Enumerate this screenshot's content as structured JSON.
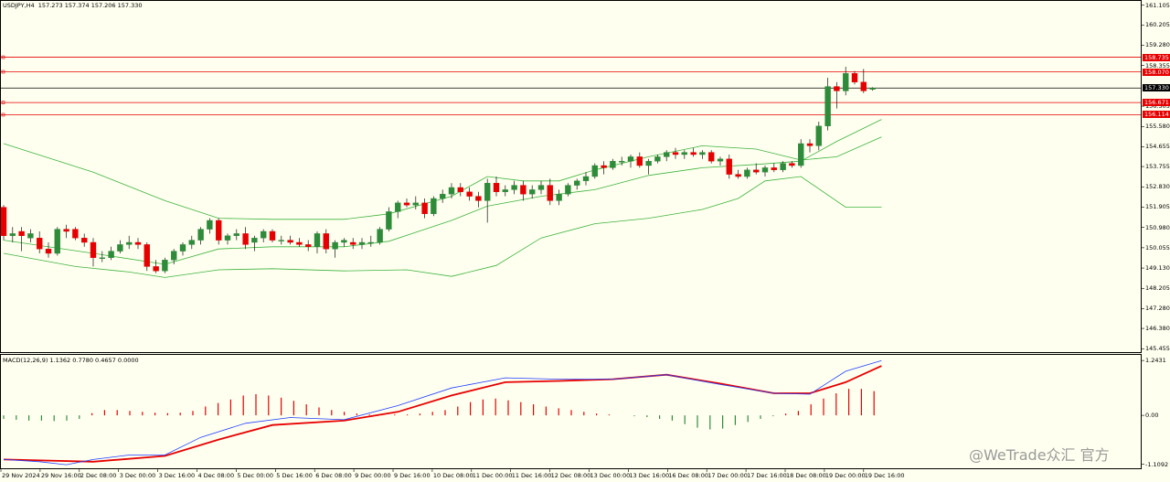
{
  "header": {
    "symbol": "USDJPY,H4",
    "ohlc": "157.273 157.374 157.206 157.330"
  },
  "macd_header": {
    "label": "MACD(12,26,9) 1.1362 0.7780 0.4657 0.0000"
  },
  "watermark": "@WeTrade众汇 官方",
  "price_labels": [
    {
      "text": "161.105",
      "v": 161.105
    },
    {
      "text": "160.205",
      "v": 160.205
    },
    {
      "text": "159.280",
      "v": 159.28
    },
    {
      "text": "158.355",
      "v": 158.355
    },
    {
      "text": "156.505",
      "v": 156.505
    },
    {
      "text": "155.580",
      "v": 155.58
    },
    {
      "text": "154.655",
      "v": 154.655
    },
    {
      "text": "153.755",
      "v": 153.755
    },
    {
      "text": "152.830",
      "v": 152.83
    },
    {
      "text": "151.905",
      "v": 151.905
    },
    {
      "text": "150.980",
      "v": 150.98
    },
    {
      "text": "150.055",
      "v": 150.055
    },
    {
      "text": "149.130",
      "v": 149.13
    },
    {
      "text": "148.205",
      "v": 148.205
    },
    {
      "text": "147.280",
      "v": 147.28
    },
    {
      "text": "146.380",
      "v": 146.38
    },
    {
      "text": "145.455",
      "v": 145.455
    }
  ],
  "level_tags": [
    {
      "text": "158.735",
      "v": 158.735,
      "color": "#e60000"
    },
    {
      "text": "158.070",
      "v": 158.07,
      "color": "#e60000"
    },
    {
      "text": "157.330",
      "v": 157.33,
      "color": "#000000"
    },
    {
      "text": "156.671",
      "v": 156.671,
      "color": "#e60000"
    },
    {
      "text": "156.114",
      "v": 156.114,
      "color": "#e60000"
    }
  ],
  "macd_labels": [
    {
      "text": "1.2431",
      "v": 1.2431
    },
    {
      "text": "0.00",
      "v": 0.0
    },
    {
      "text": "-1.1092",
      "v": -1.1092
    }
  ],
  "time_labels": [
    "29 Nov 2024",
    "29 Nov 16:00",
    "2 Dec 08:00",
    "3 Dec 00:00",
    "3 Dec 16:00",
    "4 Dec 08:00",
    "5 Dec 00:00",
    "5 Dec 16:00",
    "6 Dec 08:00",
    "9 Dec 00:00",
    "9 Dec 16:00",
    "10 Dec 08:00",
    "11 Dec 00:00",
    "11 Dec 16:00",
    "12 Dec 08:00",
    "13 Dec 00:00",
    "13 Dec 16:00",
    "16 Dec 08:00",
    "17 Dec 00:00",
    "17 Dec 16:00",
    "18 Dec 08:00",
    "19 Dec 00:00",
    "19 Dec 16:00"
  ],
  "colors": {
    "background": "#fffff0",
    "bull": "#2e8b3a",
    "bear": "#e60000",
    "bands": "#3cb43c",
    "level": "#e60000",
    "current": "#000000",
    "macd_line": "#1f3fff",
    "signal_line": "#e60000"
  },
  "chart_data": [
    {
      "type": "candlestick",
      "symbol": "USDJPY",
      "timeframe": "H4",
      "indicators": [
        "Bollinger Bands",
        "Horizontal levels"
      ],
      "ylim": [
        145.3,
        161.3
      ],
      "candles": [
        {
          "o": 151.9,
          "h": 152.0,
          "l": 150.4,
          "c": 150.6
        },
        {
          "o": 150.6,
          "h": 151.0,
          "l": 150.3,
          "c": 150.7
        },
        {
          "o": 150.8,
          "h": 151.0,
          "l": 149.9,
          "c": 150.6
        },
        {
          "o": 150.5,
          "h": 150.9,
          "l": 150.3,
          "c": 150.7
        },
        {
          "o": 150.5,
          "h": 150.8,
          "l": 149.8,
          "c": 150.0
        },
        {
          "o": 150.0,
          "h": 150.3,
          "l": 149.6,
          "c": 149.8
        },
        {
          "o": 149.8,
          "h": 151.0,
          "l": 149.7,
          "c": 150.9
        },
        {
          "o": 150.9,
          "h": 151.1,
          "l": 150.5,
          "c": 150.8
        },
        {
          "o": 150.9,
          "h": 151.0,
          "l": 150.4,
          "c": 150.5
        },
        {
          "o": 150.5,
          "h": 150.7,
          "l": 150.1,
          "c": 150.3
        },
        {
          "o": 150.3,
          "h": 150.5,
          "l": 149.2,
          "c": 149.6
        },
        {
          "o": 149.6,
          "h": 149.9,
          "l": 149.4,
          "c": 149.6
        },
        {
          "o": 149.6,
          "h": 150.1,
          "l": 149.5,
          "c": 149.9
        },
        {
          "o": 149.9,
          "h": 150.4,
          "l": 149.8,
          "c": 150.2
        },
        {
          "o": 150.2,
          "h": 150.6,
          "l": 150.0,
          "c": 150.3
        },
        {
          "o": 150.3,
          "h": 150.5,
          "l": 150.0,
          "c": 150.2
        },
        {
          "o": 150.2,
          "h": 150.3,
          "l": 149.0,
          "c": 149.2
        },
        {
          "o": 149.2,
          "h": 149.5,
          "l": 148.9,
          "c": 149.0
        },
        {
          "o": 149.0,
          "h": 149.6,
          "l": 148.9,
          "c": 149.5
        },
        {
          "o": 149.5,
          "h": 150.0,
          "l": 149.3,
          "c": 149.9
        },
        {
          "o": 149.9,
          "h": 150.3,
          "l": 149.7,
          "c": 150.2
        },
        {
          "o": 150.2,
          "h": 150.6,
          "l": 150.0,
          "c": 150.4
        },
        {
          "o": 150.4,
          "h": 151.0,
          "l": 150.2,
          "c": 150.9
        },
        {
          "o": 150.9,
          "h": 151.4,
          "l": 150.7,
          "c": 151.3
        },
        {
          "o": 151.3,
          "h": 151.4,
          "l": 150.2,
          "c": 150.4
        },
        {
          "o": 150.4,
          "h": 150.7,
          "l": 150.2,
          "c": 150.6
        },
        {
          "o": 150.6,
          "h": 150.9,
          "l": 150.4,
          "c": 150.7
        },
        {
          "o": 150.7,
          "h": 151.0,
          "l": 150.0,
          "c": 150.2
        },
        {
          "o": 150.3,
          "h": 150.6,
          "l": 149.9,
          "c": 150.5
        },
        {
          "o": 150.5,
          "h": 150.9,
          "l": 150.3,
          "c": 150.8
        },
        {
          "o": 150.8,
          "h": 150.9,
          "l": 150.3,
          "c": 150.4
        },
        {
          "o": 150.4,
          "h": 150.6,
          "l": 150.2,
          "c": 150.4
        },
        {
          "o": 150.4,
          "h": 150.6,
          "l": 150.2,
          "c": 150.3
        },
        {
          "o": 150.3,
          "h": 150.5,
          "l": 150.1,
          "c": 150.2
        },
        {
          "o": 150.2,
          "h": 150.4,
          "l": 149.9,
          "c": 150.1
        },
        {
          "o": 150.1,
          "h": 150.8,
          "l": 149.8,
          "c": 150.7
        },
        {
          "o": 150.7,
          "h": 150.9,
          "l": 149.8,
          "c": 150.0
        },
        {
          "o": 150.0,
          "h": 150.4,
          "l": 149.6,
          "c": 150.3
        },
        {
          "o": 150.3,
          "h": 150.5,
          "l": 150.1,
          "c": 150.4
        },
        {
          "o": 150.3,
          "h": 150.5,
          "l": 150.0,
          "c": 150.2
        },
        {
          "o": 150.2,
          "h": 150.5,
          "l": 150.0,
          "c": 150.3
        },
        {
          "o": 150.3,
          "h": 150.6,
          "l": 150.1,
          "c": 150.3
        },
        {
          "o": 150.3,
          "h": 151.0,
          "l": 150.2,
          "c": 150.9
        },
        {
          "o": 150.9,
          "h": 151.9,
          "l": 150.8,
          "c": 151.7
        },
        {
          "o": 151.7,
          "h": 152.2,
          "l": 151.4,
          "c": 152.1
        },
        {
          "o": 152.1,
          "h": 152.3,
          "l": 151.9,
          "c": 152.0
        },
        {
          "o": 152.0,
          "h": 152.4,
          "l": 151.8,
          "c": 152.1
        },
        {
          "o": 152.1,
          "h": 152.3,
          "l": 151.4,
          "c": 151.6
        },
        {
          "o": 151.6,
          "h": 152.4,
          "l": 151.5,
          "c": 152.3
        },
        {
          "o": 152.3,
          "h": 152.7,
          "l": 152.1,
          "c": 152.5
        },
        {
          "o": 152.5,
          "h": 153.0,
          "l": 152.3,
          "c": 152.8
        },
        {
          "o": 152.8,
          "h": 153.0,
          "l": 152.4,
          "c": 152.6
        },
        {
          "o": 152.6,
          "h": 152.8,
          "l": 152.2,
          "c": 152.4
        },
        {
          "o": 152.4,
          "h": 152.6,
          "l": 151.9,
          "c": 152.2
        },
        {
          "o": 152.2,
          "h": 153.2,
          "l": 151.2,
          "c": 153.0
        },
        {
          "o": 153.0,
          "h": 153.3,
          "l": 152.4,
          "c": 152.6
        },
        {
          "o": 152.6,
          "h": 152.9,
          "l": 152.4,
          "c": 152.7
        },
        {
          "o": 152.7,
          "h": 153.1,
          "l": 152.5,
          "c": 152.9
        },
        {
          "o": 152.9,
          "h": 153.1,
          "l": 152.2,
          "c": 152.5
        },
        {
          "o": 152.5,
          "h": 152.9,
          "l": 152.3,
          "c": 152.7
        },
        {
          "o": 152.7,
          "h": 153.1,
          "l": 152.5,
          "c": 152.9
        },
        {
          "o": 152.9,
          "h": 153.2,
          "l": 152.0,
          "c": 152.2
        },
        {
          "o": 152.2,
          "h": 152.7,
          "l": 152.0,
          "c": 152.5
        },
        {
          "o": 152.5,
          "h": 153.0,
          "l": 152.4,
          "c": 152.9
        },
        {
          "o": 152.9,
          "h": 153.2,
          "l": 152.7,
          "c": 153.1
        },
        {
          "o": 153.1,
          "h": 153.5,
          "l": 152.9,
          "c": 153.3
        },
        {
          "o": 153.3,
          "h": 153.9,
          "l": 153.2,
          "c": 153.8
        },
        {
          "o": 153.8,
          "h": 154.0,
          "l": 153.4,
          "c": 153.7
        },
        {
          "o": 153.7,
          "h": 154.1,
          "l": 153.6,
          "c": 154.0
        },
        {
          "o": 154.0,
          "h": 154.2,
          "l": 153.8,
          "c": 154.0
        },
        {
          "o": 154.0,
          "h": 154.3,
          "l": 153.7,
          "c": 154.2
        },
        {
          "o": 154.2,
          "h": 154.4,
          "l": 153.7,
          "c": 153.8
        },
        {
          "o": 153.8,
          "h": 154.1,
          "l": 153.4,
          "c": 154.0
        },
        {
          "o": 154.0,
          "h": 154.3,
          "l": 153.9,
          "c": 154.2
        },
        {
          "o": 154.2,
          "h": 154.5,
          "l": 154.0,
          "c": 154.4
        },
        {
          "o": 154.4,
          "h": 154.6,
          "l": 154.1,
          "c": 154.3
        },
        {
          "o": 154.3,
          "h": 154.5,
          "l": 154.1,
          "c": 154.4
        },
        {
          "o": 154.4,
          "h": 154.6,
          "l": 154.2,
          "c": 154.3
        },
        {
          "o": 154.3,
          "h": 154.5,
          "l": 154.1,
          "c": 154.4
        },
        {
          "o": 154.4,
          "h": 154.5,
          "l": 153.9,
          "c": 154.0
        },
        {
          "o": 154.0,
          "h": 154.2,
          "l": 153.8,
          "c": 154.1
        },
        {
          "o": 154.1,
          "h": 154.3,
          "l": 153.2,
          "c": 153.4
        },
        {
          "o": 153.4,
          "h": 153.6,
          "l": 153.2,
          "c": 153.3
        },
        {
          "o": 153.3,
          "h": 153.7,
          "l": 153.2,
          "c": 153.6
        },
        {
          "o": 153.6,
          "h": 153.9,
          "l": 153.4,
          "c": 153.5
        },
        {
          "o": 153.5,
          "h": 153.8,
          "l": 153.3,
          "c": 153.7
        },
        {
          "o": 153.7,
          "h": 153.9,
          "l": 153.5,
          "c": 153.6
        },
        {
          "o": 153.6,
          "h": 154.0,
          "l": 153.5,
          "c": 153.9
        },
        {
          "o": 153.9,
          "h": 154.0,
          "l": 153.7,
          "c": 153.8
        },
        {
          "o": 153.8,
          "h": 155.0,
          "l": 153.7,
          "c": 154.8
        },
        {
          "o": 154.8,
          "h": 155.0,
          "l": 154.4,
          "c": 154.7
        },
        {
          "o": 154.7,
          "h": 155.8,
          "l": 154.5,
          "c": 155.6
        },
        {
          "o": 155.6,
          "h": 157.8,
          "l": 155.4,
          "c": 157.4
        },
        {
          "o": 157.4,
          "h": 157.6,
          "l": 156.4,
          "c": 157.2
        },
        {
          "o": 157.2,
          "h": 158.3,
          "l": 157.0,
          "c": 158.0
        },
        {
          "o": 158.0,
          "h": 158.1,
          "l": 157.5,
          "c": 157.6
        },
        {
          "o": 157.6,
          "h": 158.2,
          "l": 157.1,
          "c": 157.2
        },
        {
          "o": 157.27,
          "h": 157.37,
          "l": 157.21,
          "c": 157.33
        }
      ],
      "bb_upper": [
        [
          0,
          154.8
        ],
        [
          10,
          153.5
        ],
        [
          18,
          152.2
        ],
        [
          24,
          151.4
        ],
        [
          30,
          151.35
        ],
        [
          38,
          151.35
        ],
        [
          43,
          151.6
        ],
        [
          50,
          152.4
        ],
        [
          54,
          153.3
        ],
        [
          58,
          153.1
        ],
        [
          62,
          153.1
        ],
        [
          66,
          153.6
        ],
        [
          72,
          154.2
        ],
        [
          78,
          154.7
        ],
        [
          84,
          154.55
        ],
        [
          89,
          154.05
        ],
        [
          93,
          154.2
        ],
        [
          98,
          155.1
        ]
      ],
      "bb_middle": [
        [
          0,
          150.4
        ],
        [
          10,
          149.8
        ],
        [
          18,
          149.3
        ],
        [
          24,
          150.0
        ],
        [
          30,
          150.1
        ],
        [
          38,
          150.1
        ],
        [
          43,
          150.35
        ],
        [
          50,
          151.3
        ],
        [
          54,
          151.95
        ],
        [
          60,
          152.4
        ],
        [
          66,
          152.7
        ],
        [
          72,
          153.35
        ],
        [
          78,
          153.7
        ],
        [
          84,
          153.85
        ],
        [
          89,
          154.0
        ],
        [
          93,
          154.9
        ],
        [
          98,
          155.9
        ]
      ],
      "bb_lower": [
        [
          0,
          149.8
        ],
        [
          8,
          149.2
        ],
        [
          14,
          148.95
        ],
        [
          18,
          148.7
        ],
        [
          24,
          149.05
        ],
        [
          30,
          149.1
        ],
        [
          38,
          149.0
        ],
        [
          45,
          149.05
        ],
        [
          50,
          148.75
        ],
        [
          55,
          149.25
        ],
        [
          60,
          150.5
        ],
        [
          66,
          151.15
        ],
        [
          72,
          151.4
        ],
        [
          78,
          151.8
        ],
        [
          82,
          152.3
        ],
        [
          85,
          153.1
        ],
        [
          89,
          153.3
        ],
        [
          94,
          151.9
        ],
        [
          98,
          151.9
        ]
      ],
      "levels": [
        158.735,
        158.07,
        156.671,
        156.114
      ],
      "current_price": 157.33
    },
    {
      "type": "line",
      "title": "MACD(12,26,9)",
      "values_header": [
        1.1362,
        0.778,
        0.4657,
        0.0
      ],
      "ylim": [
        -1.2,
        1.35
      ],
      "histogram": [
        -0.08,
        -0.1,
        -0.12,
        -0.12,
        -0.13,
        -0.12,
        -0.08,
        0.05,
        0.12,
        0.12,
        0.1,
        0.08,
        0.06,
        0.05,
        0.06,
        0.1,
        0.2,
        0.28,
        0.36,
        0.45,
        0.48,
        0.45,
        0.4,
        0.33,
        0.25,
        0.18,
        0.12,
        0.08,
        0.04,
        0.02,
        0.02,
        0.02,
        0.02,
        0.04,
        0.08,
        0.12,
        0.2,
        0.3,
        0.36,
        0.38,
        0.34,
        0.3,
        0.25,
        0.2,
        0.16,
        0.12,
        0.08,
        0.04,
        0.02,
        0.0,
        -0.02,
        -0.04,
        -0.08,
        -0.12,
        -0.2,
        -0.28,
        -0.32,
        -0.3,
        -0.22,
        -0.15,
        -0.08,
        -0.02,
        0.04,
        0.1,
        0.25,
        0.38,
        0.5,
        0.6,
        0.6,
        0.55
      ],
      "macd": [
        [
          0,
          -1.0
        ],
        [
          4,
          -1.05
        ],
        [
          7,
          -1.12
        ],
        [
          10,
          -1.0
        ],
        [
          14,
          -0.9
        ],
        [
          18,
          -0.9
        ],
        [
          22,
          -0.5
        ],
        [
          27,
          -0.18
        ],
        [
          32,
          -0.05
        ],
        [
          38,
          -0.1
        ],
        [
          44,
          0.22
        ],
        [
          50,
          0.62
        ],
        [
          56,
          0.85
        ],
        [
          62,
          0.82
        ],
        [
          68,
          0.82
        ],
        [
          74,
          0.92
        ],
        [
          80,
          0.7
        ],
        [
          86,
          0.5
        ],
        [
          90,
          0.48
        ],
        [
          94,
          1.0
        ],
        [
          98,
          1.24
        ]
      ],
      "signal": [
        [
          0,
          -1.0
        ],
        [
          10,
          -1.05
        ],
        [
          18,
          -0.92
        ],
        [
          24,
          -0.55
        ],
        [
          30,
          -0.22
        ],
        [
          38,
          -0.12
        ],
        [
          44,
          0.08
        ],
        [
          50,
          0.45
        ],
        [
          56,
          0.75
        ],
        [
          62,
          0.78
        ],
        [
          68,
          0.82
        ],
        [
          74,
          0.92
        ],
        [
          80,
          0.72
        ],
        [
          86,
          0.5
        ],
        [
          90,
          0.5
        ],
        [
          94,
          0.75
        ],
        [
          98,
          1.12
        ]
      ]
    }
  ]
}
